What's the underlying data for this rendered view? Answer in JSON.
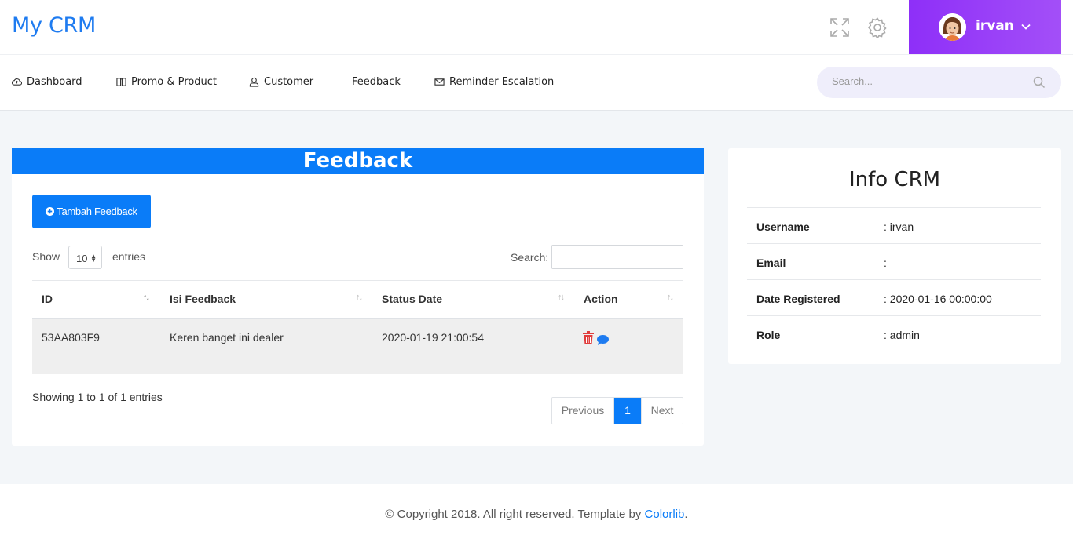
{
  "header": {
    "logo": "My CRM",
    "user_name": "irvan",
    "icons": [
      "fullscreen-icon",
      "gear-icon",
      "chevron-down-icon"
    ]
  },
  "nav": {
    "items": [
      {
        "label": "Dashboard",
        "icon": "cloud-icon"
      },
      {
        "label": "Promo & Product",
        "icon": "book-icon"
      },
      {
        "label": "Customer",
        "icon": "user-icon"
      },
      {
        "label": "Feedback",
        "icon": ""
      },
      {
        "label": "Reminder Escalation",
        "icon": "envelope-icon"
      }
    ],
    "search_placeholder": "Search..."
  },
  "main": {
    "title": "Feedback",
    "add_button": "Tambah Feedback",
    "show_label": "Show",
    "entries_label": "entries",
    "page_length": "10",
    "search_label": "Search:",
    "columns": [
      "ID",
      "Isi Feedback",
      "Status Date",
      "Action"
    ],
    "rows": [
      {
        "id": "53AA803F9",
        "feedback": "Keren banget ini dealer",
        "date": "2020-01-19 21:00:54"
      }
    ],
    "info": "Showing 1 to 1 of 1 entries",
    "pagination": {
      "previous": "Previous",
      "current": "1",
      "next": "Next"
    }
  },
  "info_crm": {
    "title": "Info CRM",
    "rows": [
      {
        "key": "Username",
        "value": ": irvan"
      },
      {
        "key": "Email",
        "value": ":"
      },
      {
        "key": "Date Registered",
        "value": ": 2020-01-16 00:00:00"
      },
      {
        "key": "Role",
        "value": ": admin"
      }
    ]
  },
  "footer": {
    "text": "© Copyright 2018. All right reserved. Template by ",
    "link": "Colorlib",
    "end": "."
  },
  "colors": {
    "accent": "#0a7cf8",
    "user_gradient_start": "#8e2ff8",
    "user_gradient_end": "#a34ff8"
  }
}
